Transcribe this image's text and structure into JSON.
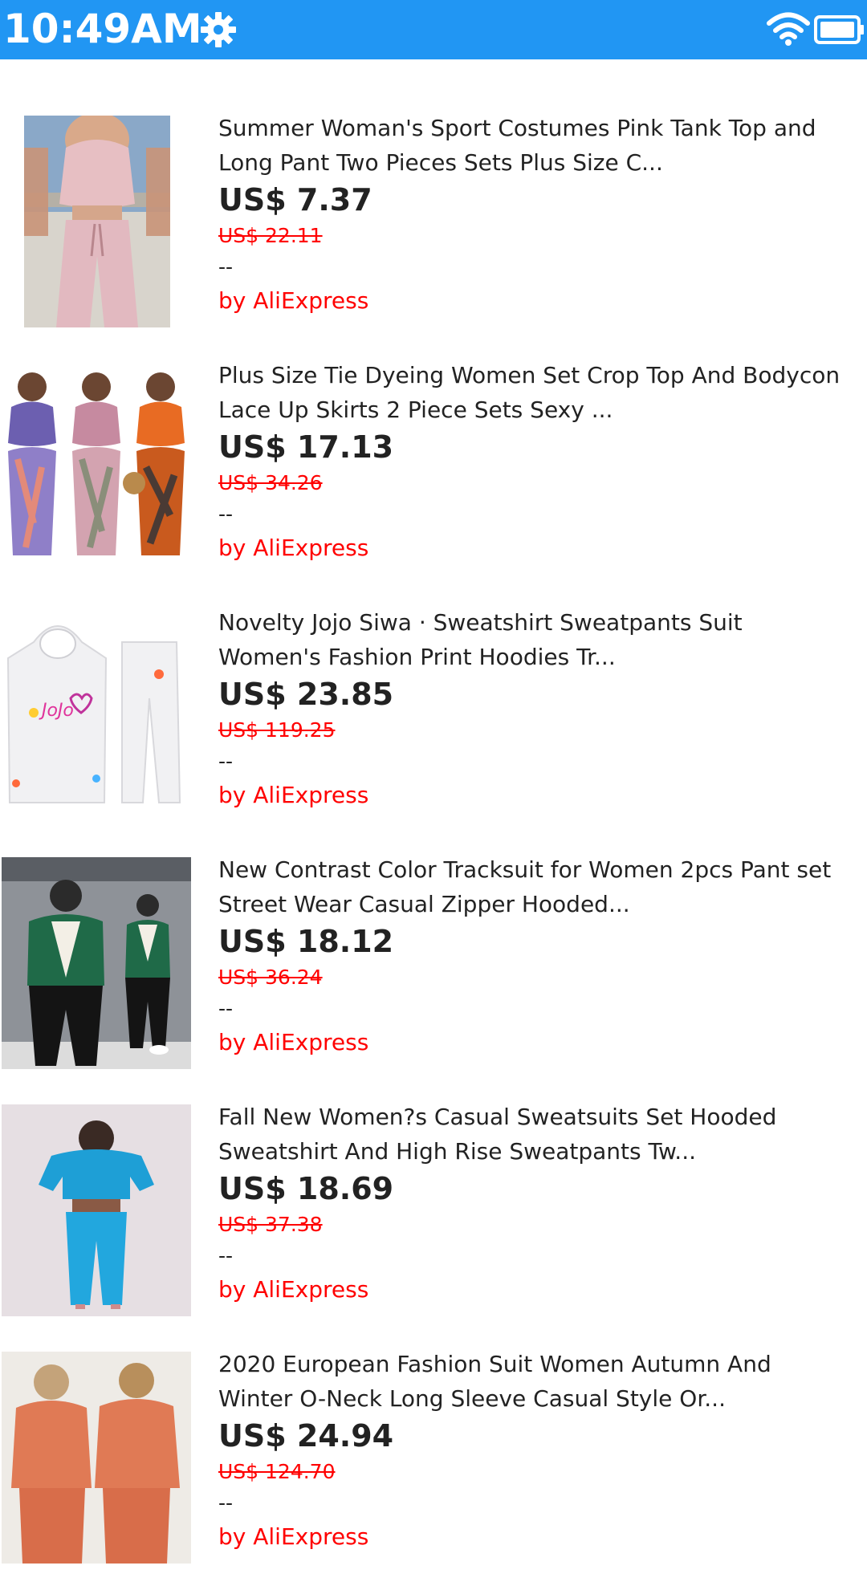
{
  "status_bar": {
    "time": "10:49AM",
    "background": "#2196f3",
    "icons": [
      "gear-icon",
      "wifi-icon",
      "battery-icon"
    ]
  },
  "products": [
    {
      "title_line1": "Summer Woman's Sport Costumes Pink Tank Top and",
      "title_line2": "Long Pant Two Pieces Sets Plus Size C...",
      "price": "US$ 7.37",
      "old_price": "US$ 22.11",
      "rating": "--",
      "seller": "by AliExpress",
      "image": "pink-tank-top-pants-set"
    },
    {
      "title_line1": "Plus Size Tie Dyeing Women Set Crop Top And Bodycon",
      "title_line2": "Lace Up Skirts 2 Piece Sets Sexy ...",
      "price": "US$ 17.13",
      "old_price": "US$ 34.26",
      "rating": "--",
      "seller": "by AliExpress",
      "image": "tie-dye-skirt-sets"
    },
    {
      "title_line1": "Novelty Jojo Siwa · Sweatshirt Sweatpants Suit",
      "title_line2": "Women's Fashion Print Hoodies Tr...",
      "price": "US$ 23.85",
      "old_price": "US$ 119.25",
      "rating": "--",
      "seller": "by AliExpress",
      "image": "white-hoodie-sweatpants"
    },
    {
      "title_line1": "New Contrast Color Tracksuit for Women 2pcs Pant set",
      "title_line2": "Street Wear Casual Zipper Hooded...",
      "price": "US$ 18.12",
      "old_price": "US$ 36.24",
      "rating": "--",
      "seller": "by AliExpress",
      "image": "green-black-tracksuit"
    },
    {
      "title_line1": "Fall New Women?s Casual Sweatsuits Set Hooded",
      "title_line2": "Sweatshirt And High Rise Sweatpants Tw...",
      "price": "US$ 18.69",
      "old_price": "US$ 37.38",
      "rating": "--",
      "seller": "by AliExpress",
      "image": "blue-sweatsuit"
    },
    {
      "title_line1": "2020 European Fashion Suit Women Autumn And",
      "title_line2": "Winter O-Neck Long Sleeve Casual Style Or...",
      "price": "US$ 24.94",
      "old_price": "US$ 124.70",
      "rating": "--",
      "seller": "by AliExpress",
      "image": "orange-long-sleeve-suit"
    }
  ]
}
